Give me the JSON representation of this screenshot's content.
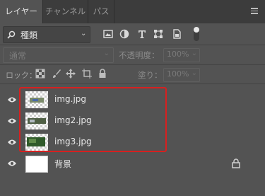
{
  "tabs": [
    {
      "label": "レイヤー",
      "active": true
    },
    {
      "label": "チャンネル",
      "active": false
    },
    {
      "label": "パス",
      "active": false
    }
  ],
  "filter": {
    "label": "種類"
  },
  "blend_mode": {
    "value": "通常"
  },
  "opacity": {
    "label": "不透明度：",
    "value": "100%"
  },
  "lock": {
    "label": "ロック："
  },
  "fill": {
    "label": "塗り：",
    "value": "100%"
  },
  "layers": [
    {
      "name": "img.jpg"
    },
    {
      "name": "img2.jpg"
    },
    {
      "name": "img3.jpg"
    },
    {
      "name": "背景"
    }
  ],
  "colors": {
    "panel": "#535353",
    "tabbar": "#3c3c3c",
    "highlight": "#d62020"
  }
}
